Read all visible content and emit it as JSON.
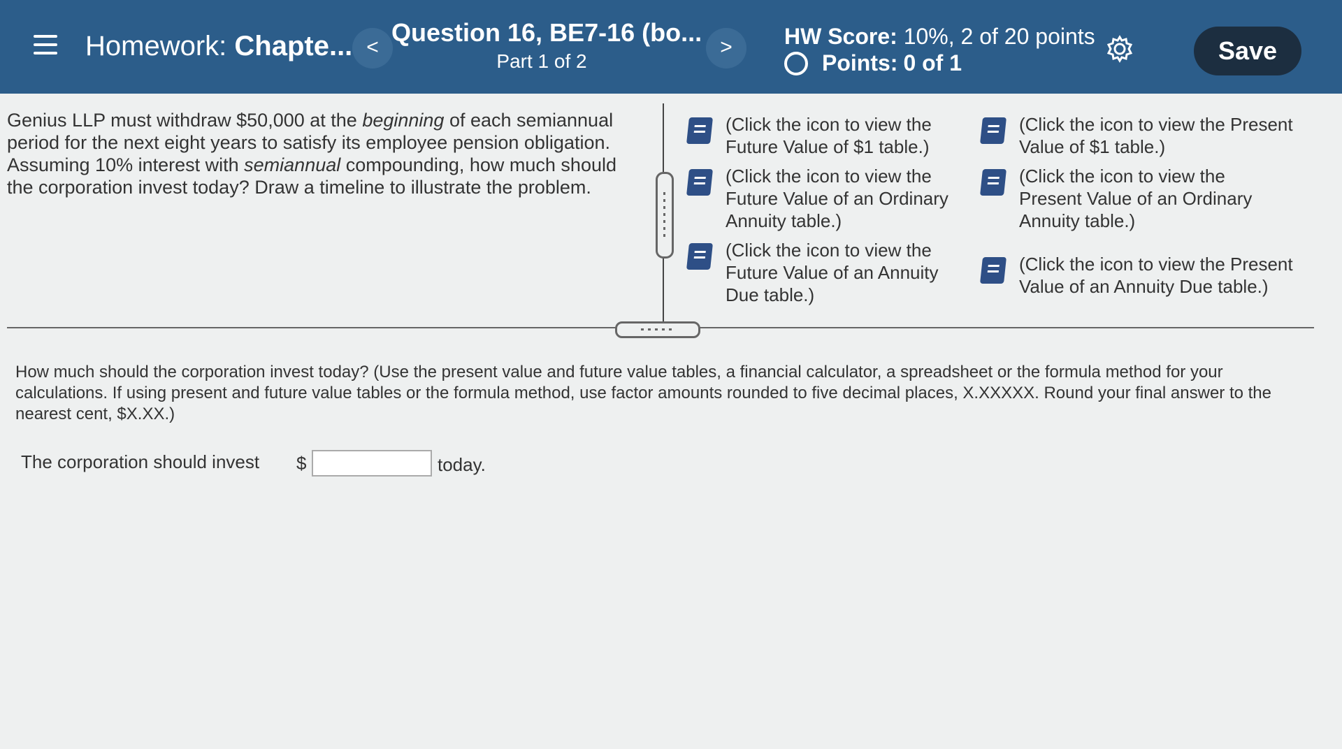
{
  "header": {
    "homework_label": "Homework:",
    "chapter_label": "Chapte...",
    "prev_glyph": "<",
    "next_glyph": ">",
    "question_title": "Question 16, BE7-16 (bo...",
    "part": "Part 1 of 2",
    "hw_score_label": "HW Score:",
    "hw_score_value": "10%, 2 of 20 points",
    "points_label": "Points:",
    "points_value": "0 of 1",
    "save_label": "Save"
  },
  "question": {
    "t1": "Genius LLP must withdraw $50,000 at the ",
    "em1": "beginning",
    "t2": " of each semiannual period for the next eight years to satisfy its employee pension obligation. Assuming 10% interest with ",
    "em2": "semiannual",
    "t3": " compounding, how much should the corporation invest today? Draw a timeline to illustrate the problem."
  },
  "tables": [
    {
      "label": "(Click the icon to view the Future Value of $1 table.)",
      "icon": "book-icon"
    },
    {
      "label": "(Click the icon to view the Present Value of $1 table.)",
      "icon": "book-icon"
    },
    {
      "label": "(Click the icon to view the Future Value of an Ordinary Annuity table.)",
      "icon": "book-icon"
    },
    {
      "label": "(Click the icon to view the Present Value of an Ordinary Annuity table.)",
      "icon": "book-icon"
    },
    {
      "label": "(Click the icon to view the Future Value of an Annuity Due table.)",
      "icon": "book-icon"
    },
    {
      "label": "(Click the icon to view the Present Value of an Annuity Due table.)",
      "icon": "book-icon"
    }
  ],
  "instructions": "How much should the corporation invest today? (Use the present value and future value tables, a financial calculator, a spreadsheet or the formula method for your calculations. If using present and future value tables or the formula method, use factor amounts rounded to five decimal places, X.XXXXX. Round your final answer to the nearest cent, $X.XX.)",
  "answer": {
    "label": "The corporation should invest",
    "currency": "$",
    "value": "",
    "suffix": "today."
  },
  "colors": {
    "header_bg": "#2c5d8a",
    "save_bg": "#1c2e40",
    "icon_blue": "#2e4f86"
  }
}
